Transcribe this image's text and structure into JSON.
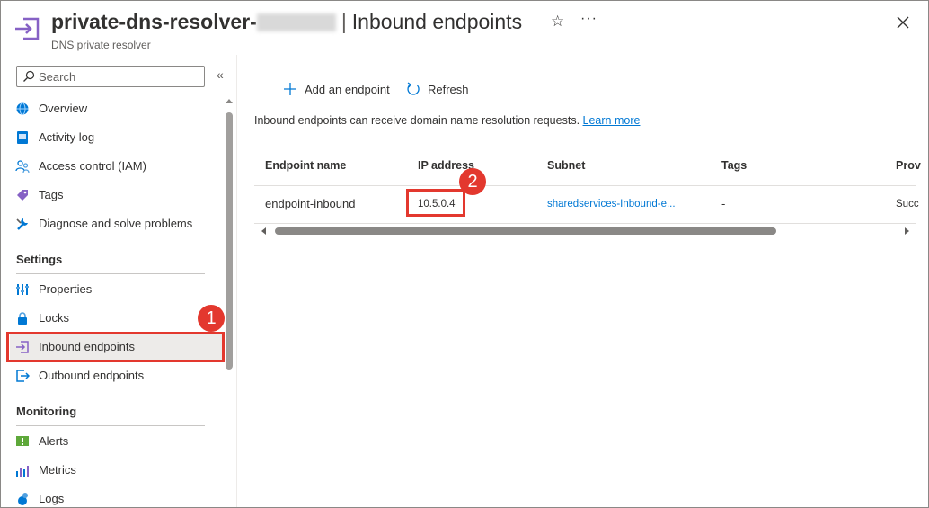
{
  "header": {
    "title_name": "private-dns-resolver-",
    "title_separator": "|",
    "title_page": "Inbound endpoints",
    "subtitle": "DNS private resolver",
    "star_glyph": "☆",
    "more_glyph": "···"
  },
  "sidebar": {
    "search_placeholder": "Search",
    "collapse_glyph": "«",
    "items_top": [
      {
        "label": "Overview",
        "icon": "overview-globe-icon"
      },
      {
        "label": "Activity log",
        "icon": "activity-log-icon"
      },
      {
        "label": "Access control (IAM)",
        "icon": "iam-people-icon"
      },
      {
        "label": "Tags",
        "icon": "tag-icon"
      },
      {
        "label": "Diagnose and solve problems",
        "icon": "wrench-icon"
      }
    ],
    "settings_header": "Settings",
    "settings_items": [
      {
        "label": "Properties",
        "icon": "properties-icon"
      },
      {
        "label": "Locks",
        "icon": "lock-icon"
      },
      {
        "label": "Inbound endpoints",
        "icon": "inbound-endpoint-icon"
      },
      {
        "label": "Outbound endpoints",
        "icon": "outbound-endpoint-icon"
      }
    ],
    "monitoring_header": "Monitoring",
    "monitoring_items": [
      {
        "label": "Alerts",
        "icon": "alert-icon"
      },
      {
        "label": "Metrics",
        "icon": "metrics-icon"
      },
      {
        "label": "Logs",
        "icon": "logs-icon"
      }
    ]
  },
  "toolbar": {
    "add_label": "Add an endpoint",
    "refresh_label": "Refresh"
  },
  "info": {
    "text": "Inbound endpoints can receive domain name resolution requests.",
    "link": "Learn more"
  },
  "table": {
    "columns": [
      "Endpoint name",
      "IP address",
      "Subnet",
      "Tags",
      "Prov"
    ],
    "rows": [
      {
        "name": "endpoint-inbound",
        "ip": "10.5.0.4",
        "subnet": "sharedservices-Inbound-e...",
        "tags": "-",
        "provisioning": "Succ"
      }
    ]
  },
  "callouts": {
    "one": "1",
    "two": "2"
  },
  "colors": {
    "accent": "#0078d4",
    "highlight": "#e3382e",
    "active_bg": "#edebe9",
    "endpoint_icon": "#8661c5"
  }
}
